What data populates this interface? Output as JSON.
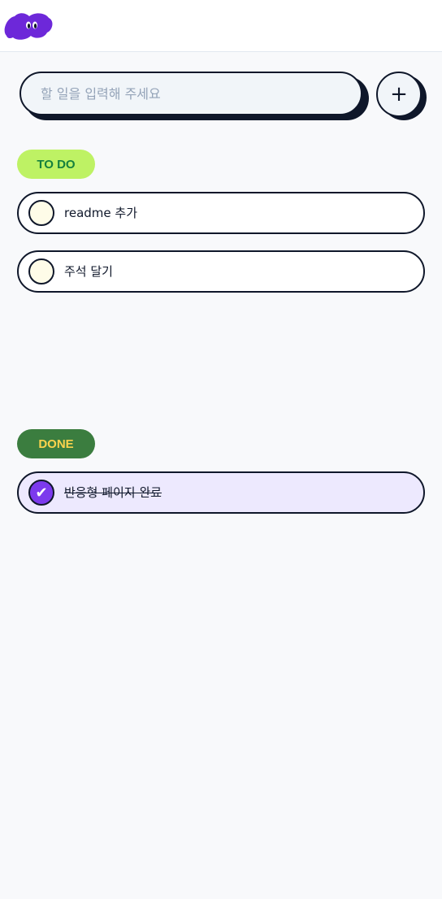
{
  "input": {
    "placeholder": "할 일을 입력해 주세요"
  },
  "add_button": {
    "label": "+"
  },
  "sections": {
    "todo": {
      "label": "TO DO",
      "items": [
        {
          "text": "readme 추가"
        },
        {
          "text": "주석 달기"
        }
      ]
    },
    "done": {
      "label": "DONE",
      "items": [
        {
          "text": "반응형 페이지 완료",
          "check_glyph": "✔"
        }
      ]
    }
  },
  "colors": {
    "logo": "#6d28d9",
    "todo_pill": "#bef264",
    "done_pill": "#3b7d3f",
    "done_item_bg": "#ede9fe",
    "check_fill": "#7c3aed"
  }
}
